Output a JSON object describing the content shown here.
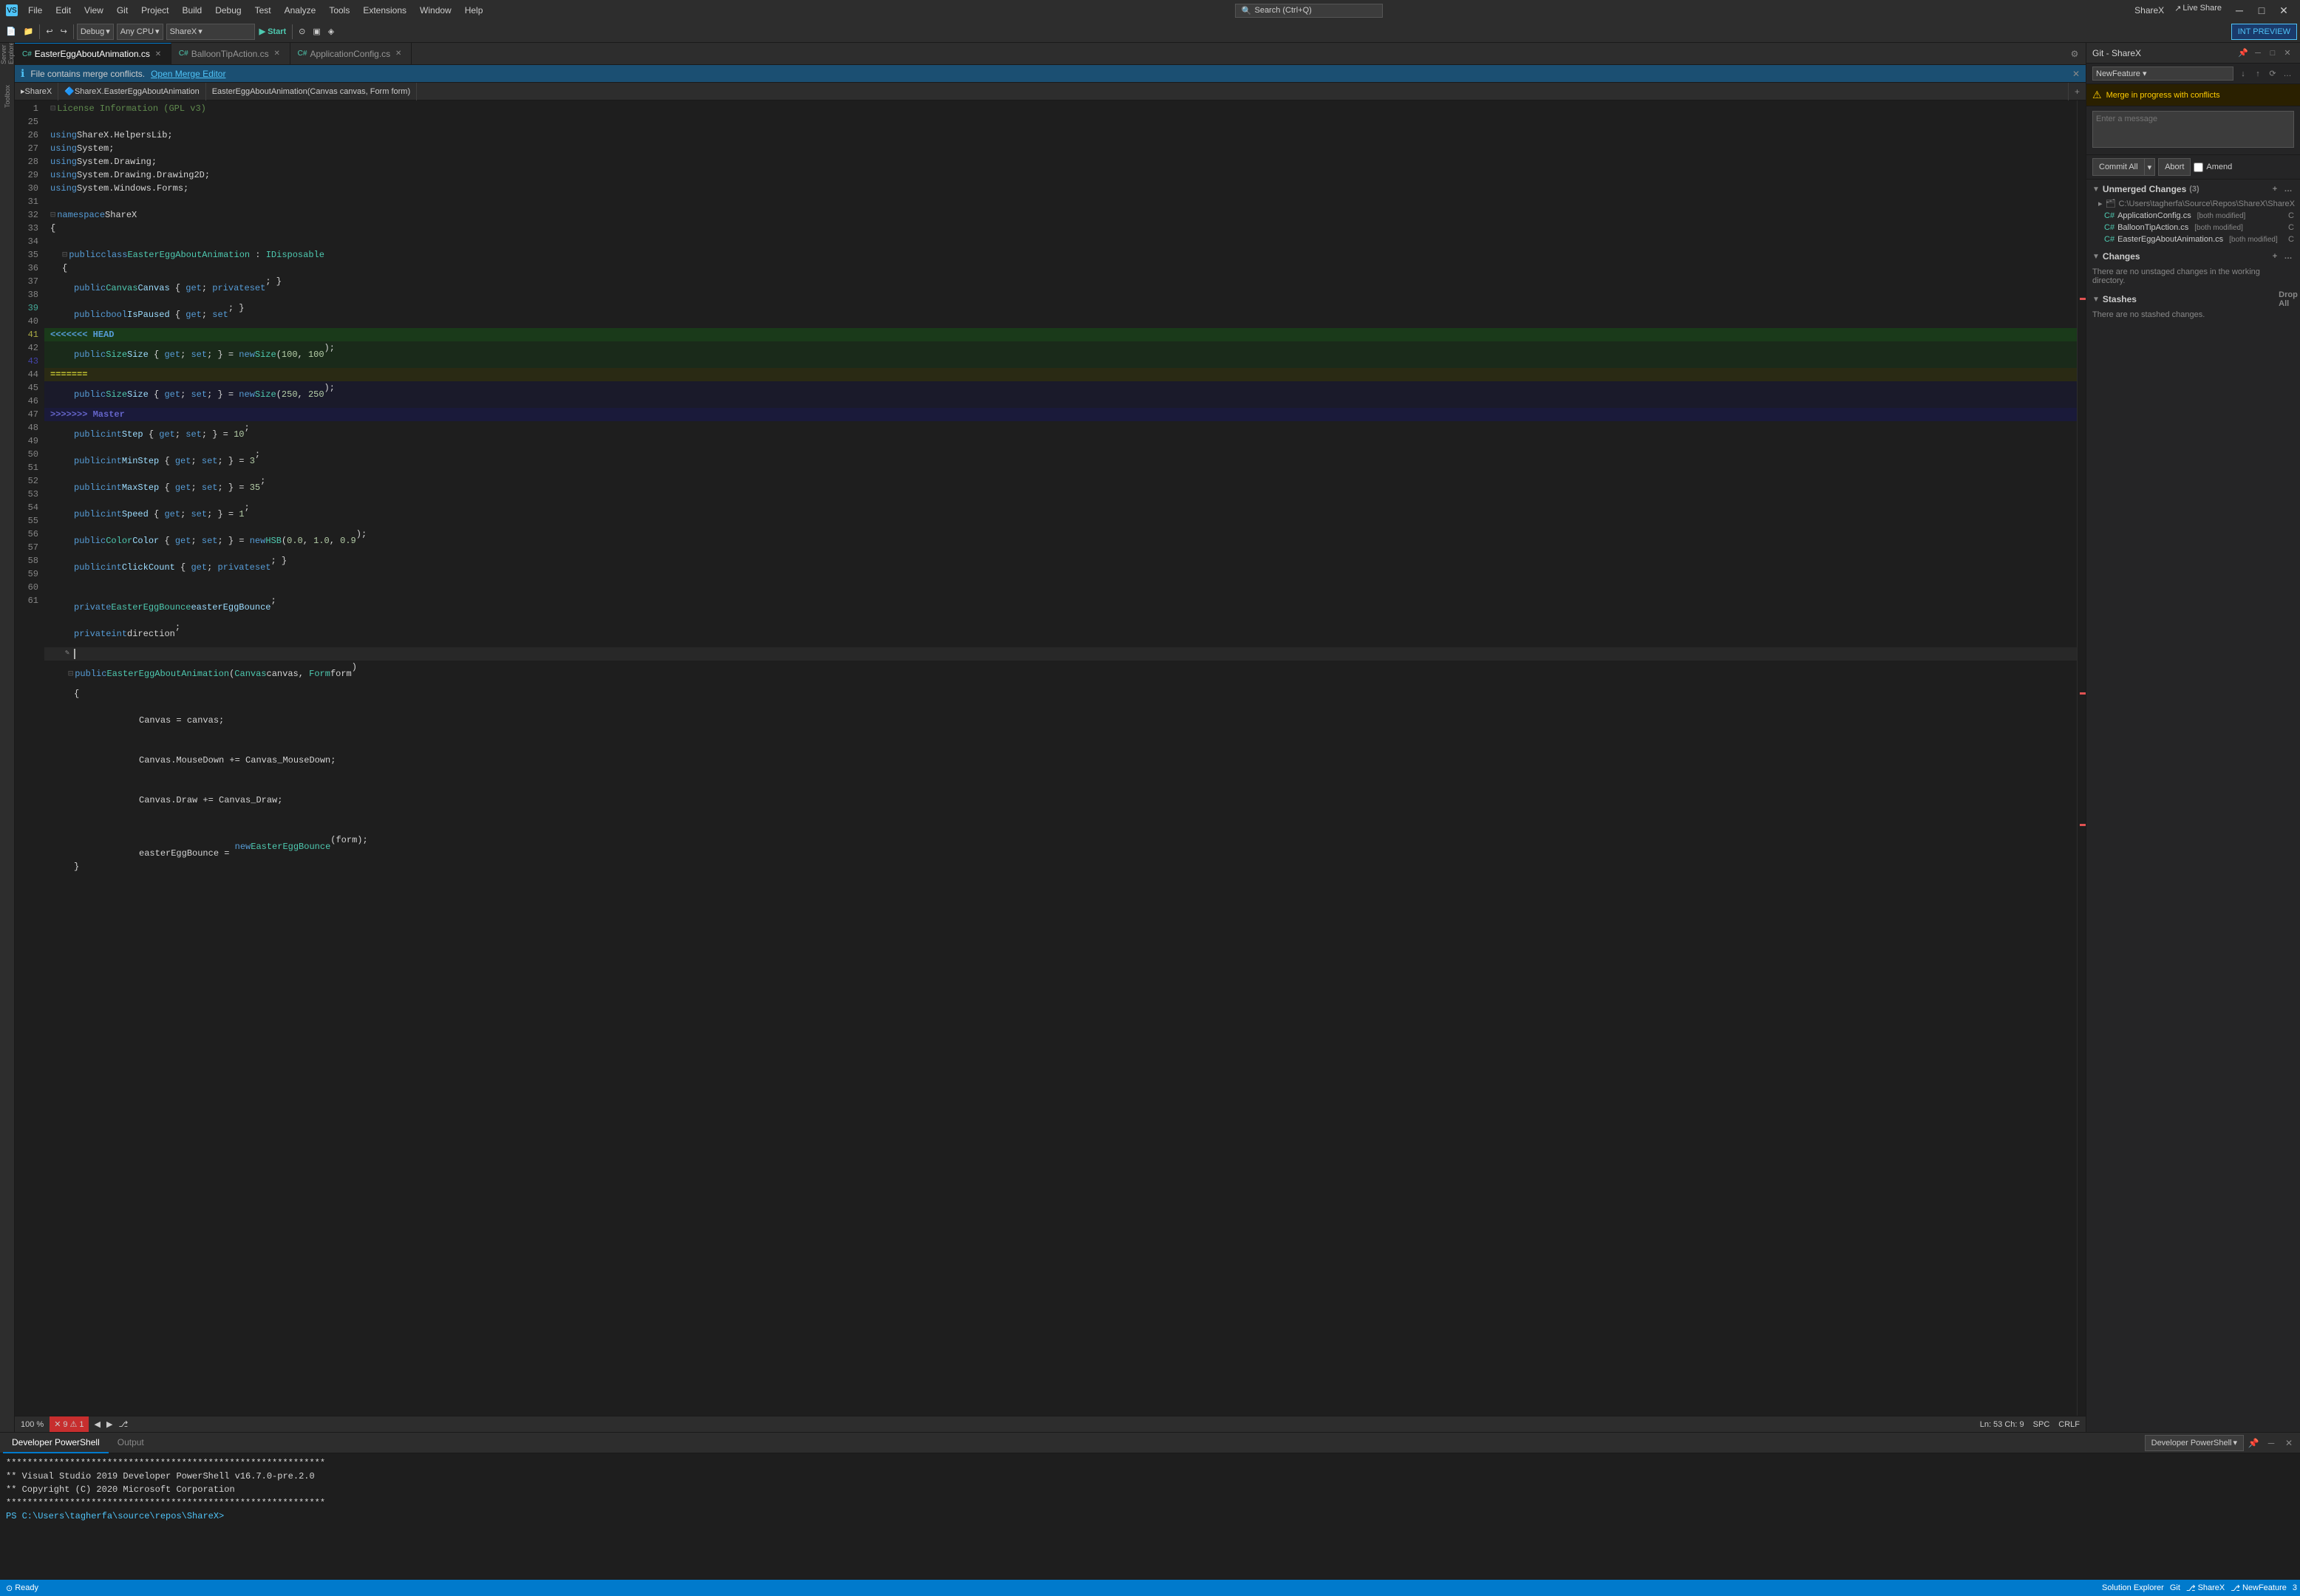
{
  "titleBar": {
    "icon": "VS",
    "menus": [
      "File",
      "Edit",
      "View",
      "Git",
      "Project",
      "Build",
      "Debug",
      "Test",
      "Analyze",
      "Tools",
      "Extensions",
      "Window",
      "Help"
    ],
    "searchPlaceholder": "Search (Ctrl+Q)",
    "title": "ShareX",
    "buttons": [
      "─",
      "□",
      "✕"
    ]
  },
  "toolbar": {
    "debugMode": "Debug",
    "platform": "Any CPU",
    "project": "ShareX",
    "startBtn": "▶ Start",
    "liveShare": "Live Share",
    "intPreview": "INT PREVIEW"
  },
  "tabs": [
    {
      "name": "EasterEggAboutAnimation.cs",
      "active": true,
      "modified": false
    },
    {
      "name": "BalloonTipAction.cs",
      "active": false,
      "modified": false
    },
    {
      "name": "ApplicationConfig.cs",
      "active": false,
      "modified": false
    }
  ],
  "infoBar": {
    "message": "File contains merge conflicts.",
    "linkText": "Open Merge Editor"
  },
  "navBar": {
    "project": "ShareX",
    "namespace": "ShareX.EasterEggAboutAnimation",
    "method": "EasterEggAboutAnimation(Canvas canvas, Form form)"
  },
  "codeLines": [
    {
      "num": 1,
      "text": "License Information (GPL v3)"
    },
    {
      "num": 25,
      "text": ""
    },
    {
      "num": 26,
      "text": "using ShareX.HelpersLib;"
    },
    {
      "num": 27,
      "text": "using System;"
    },
    {
      "num": 28,
      "text": "using System.Drawing;"
    },
    {
      "num": 29,
      "text": "using System.Drawing.Drawing2D;"
    },
    {
      "num": 30,
      "text": "using System.Windows.Forms;"
    },
    {
      "num": 31,
      "text": ""
    },
    {
      "num": 32,
      "text": "namespace ShareX"
    },
    {
      "num": 33,
      "text": "{"
    },
    {
      "num": 34,
      "text": ""
    },
    {
      "num": 35,
      "text": "    public class EasterEggAboutAnimation : IDisposable"
    },
    {
      "num": 36,
      "text": "    {"
    },
    {
      "num": 37,
      "text": "        public Canvas Canvas { get; private set; }"
    },
    {
      "num": 38,
      "text": "        public bool IsPaused { get; set; }"
    },
    {
      "num": 39,
      "text": "<<<<<<< HEAD",
      "type": "conflict-head"
    },
    {
      "num": 40,
      "text": "        public Size Size { get; set; } = new Size(100, 100);"
    },
    {
      "num": 41,
      "text": "=======",
      "type": "conflict-sep"
    },
    {
      "num": 42,
      "text": "        public Size Size { get; set; } = new Size(250, 250);"
    },
    {
      "num": 43,
      "text": ">>>>>>> Master",
      "type": "conflict-master"
    },
    {
      "num": 44,
      "text": "        public int Step { get; set; } = 10;"
    },
    {
      "num": 45,
      "text": "        public int MinStep { get; set; } = 3;"
    },
    {
      "num": 46,
      "text": "        public int MaxStep { get; set; } = 35;"
    },
    {
      "num": 47,
      "text": "        public int Speed { get; set; } = 1;"
    },
    {
      "num": 48,
      "text": "        public Color Color { get; set; } = new HSB(0.0, 1.0, 0.9);"
    },
    {
      "num": 49,
      "text": "        public int ClickCount { get; private set; }"
    },
    {
      "num": 50,
      "text": ""
    },
    {
      "num": 51,
      "text": "        private EasterEggBounce easterEggBounce;"
    },
    {
      "num": 52,
      "text": "        private int direction;"
    },
    {
      "num": 53,
      "text": "",
      "active": true
    },
    {
      "num": 54,
      "text": "        public EasterEggAboutAnimation(Canvas canvas, Form form)"
    },
    {
      "num": 55,
      "text": "        {"
    },
    {
      "num": 56,
      "text": "            Canvas = canvas;"
    },
    {
      "num": 57,
      "text": "            Canvas.MouseDown += Canvas_MouseDown;"
    },
    {
      "num": 58,
      "text": "            Canvas.Draw += Canvas_Draw;"
    },
    {
      "num": 59,
      "text": ""
    },
    {
      "num": 60,
      "text": "            easterEggBounce = new EasterEggBounce(form);"
    },
    {
      "num": 61,
      "text": "        }"
    }
  ],
  "gitPanel": {
    "title": "Git - ShareX",
    "branch": "NewFeature",
    "mergeMessage": "Merge in progress with conflicts",
    "commitPlaceholder": "Enter a message",
    "commitAllLabel": "Commit All",
    "abortLabel": "Abort",
    "amendLabel": "Amend",
    "unmergedSection": {
      "label": "Unmerged Changes",
      "count": "(3)",
      "repoPath": "C:\\Users\\tagherfa\\Source\\Repos\\ShareX\\ShareX",
      "files": [
        {
          "name": "ApplicationConfig.cs",
          "status": "[both modified]",
          "letter": "C"
        },
        {
          "name": "BalloonTipAction.cs",
          "status": "[both modified]",
          "letter": "C"
        },
        {
          "name": "EasterEggAboutAnimation.cs",
          "status": "[both modified]",
          "letter": "C"
        }
      ]
    },
    "changesSection": {
      "label": "Changes",
      "message": "There are no unstaged changes in the working directory."
    },
    "stashesSection": {
      "label": "Stashes",
      "dropAll": "Drop All",
      "message": "There are no stashed changes."
    }
  },
  "bottomPanel": {
    "tabs": [
      "Developer PowerShell",
      "Output"
    ],
    "activeTab": "Developer PowerShell",
    "dropdownLabel": "Developer PowerShell",
    "terminalLines": [
      "************************************************************",
      "** Visual Studio 2019 Developer PowerShell v16.7.0-pre.2.0",
      "** Copyright (C) 2020 Microsoft Corporation",
      "************************************************************",
      "PS C:\\Users\\tagherfa\\source\\repos\\ShareX> "
    ]
  },
  "statusBar": {
    "errors": "9",
    "warnings": "1",
    "backNav": "◀",
    "forwardNav": "▶",
    "gitBranch": "⎇ NewFeature",
    "position": "Ln: 53  Ch: 9",
    "encoding": "SPC",
    "lineEnding": "CRLF",
    "zoom": "100 %",
    "solutionExplorer": "Solution Explorer",
    "git": "Git",
    "bottomBranch": "ShareX",
    "newFeature": "NewFeature",
    "readyText": "Ready",
    "statusNum": "3"
  }
}
